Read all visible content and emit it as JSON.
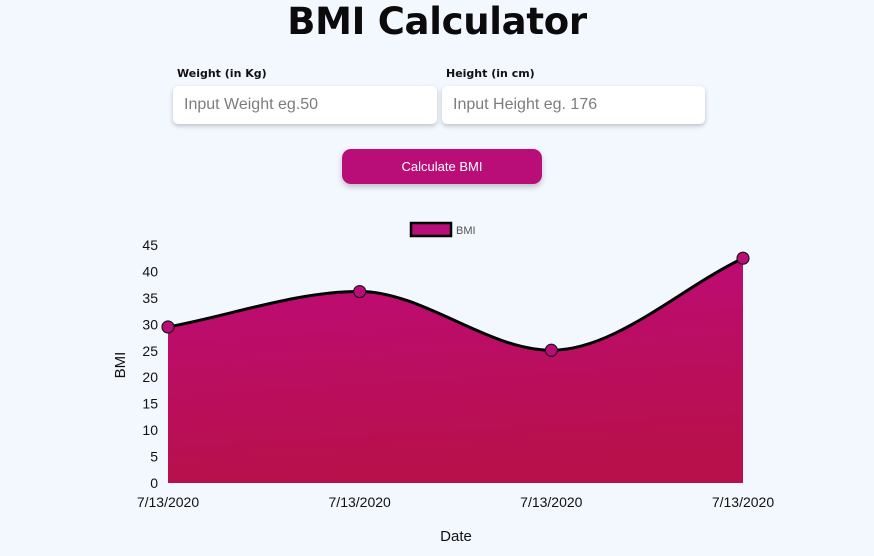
{
  "header": {
    "title": "BMI Calculator"
  },
  "form": {
    "weight_label": "Weight (in Kg)",
    "weight_placeholder": "Input Weight eg.50",
    "weight_value": "",
    "height_label": "Height (in cm)",
    "height_placeholder": "Input Height eg. 176",
    "height_value": "",
    "calculate_label": "Calculate BMI"
  },
  "colors": {
    "accent": "#b90e78",
    "fill_top": "#bd0b7a",
    "fill_bottom": "#b8104a",
    "line": "#000000",
    "background": "#f3f7fe"
  },
  "chart_data": {
    "type": "area",
    "x": [
      "7/13/2020",
      "7/13/2020",
      "7/13/2020",
      "7/13/2020"
    ],
    "series": [
      {
        "name": "BMI",
        "values": [
          29.5,
          36.2,
          25.1,
          42.5
        ]
      }
    ],
    "xlabel": "Date",
    "ylabel": "BMI",
    "ylim": [
      0,
      45
    ],
    "yticks": [
      0,
      5,
      10,
      15,
      20,
      25,
      30,
      35,
      40,
      45
    ],
    "grid": false,
    "legend": "top-center",
    "smooth": true
  }
}
